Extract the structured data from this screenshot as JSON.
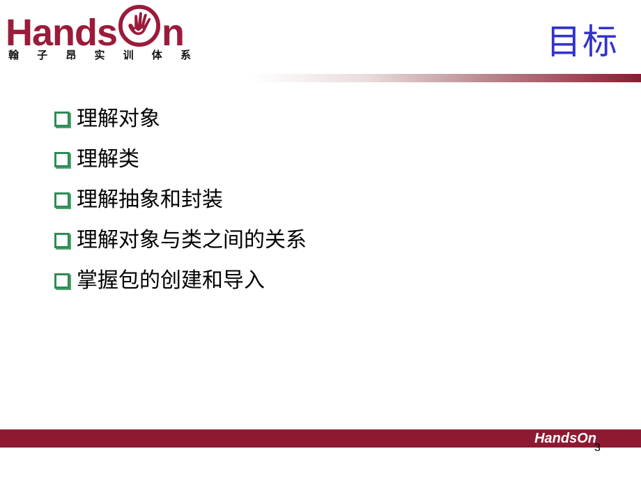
{
  "logo": {
    "word_left": "Hands",
    "word_right": "n",
    "subtitle_chars": [
      "翰",
      "子",
      "昂",
      "实",
      "训",
      "体",
      "系"
    ],
    "brand_color": "#9b1b3a"
  },
  "slide": {
    "title": "目标",
    "title_color": "#3333cc",
    "bullets": [
      "理解对象",
      "理解类",
      "理解抽象和封装",
      "理解对象与类之间的关系",
      "掌握包的创建和导入"
    ],
    "bullet_icon": "hollow-square-bullet-icon",
    "bullet_color": "#2e8b57"
  },
  "footer": {
    "brand": "HandsOn",
    "bar_color": "#8e1a32",
    "page_number": "3"
  }
}
